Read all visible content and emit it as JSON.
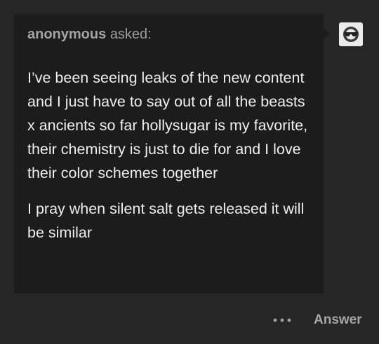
{
  "ask": {
    "asker_name": "anonymous",
    "asked_label": "asked:",
    "paragraphs": [
      "I’ve been seeing leaks of the new content and I just have to say out of all the beasts x ancients so far hollysugar is my favorite, their chemistry is just to die for and I love their color schemes together",
      "I pray when silent salt gets released it will be similar"
    ],
    "avatar_icon": "anonymous-sunglasses-icon"
  },
  "actions": {
    "more_icon": "ellipsis-icon",
    "answer_label": "Answer"
  },
  "colors": {
    "page_background": "#262626",
    "card_background": "#1c1c1c",
    "body_text": "#eeeeee",
    "muted_text": "#a3a3a3"
  }
}
